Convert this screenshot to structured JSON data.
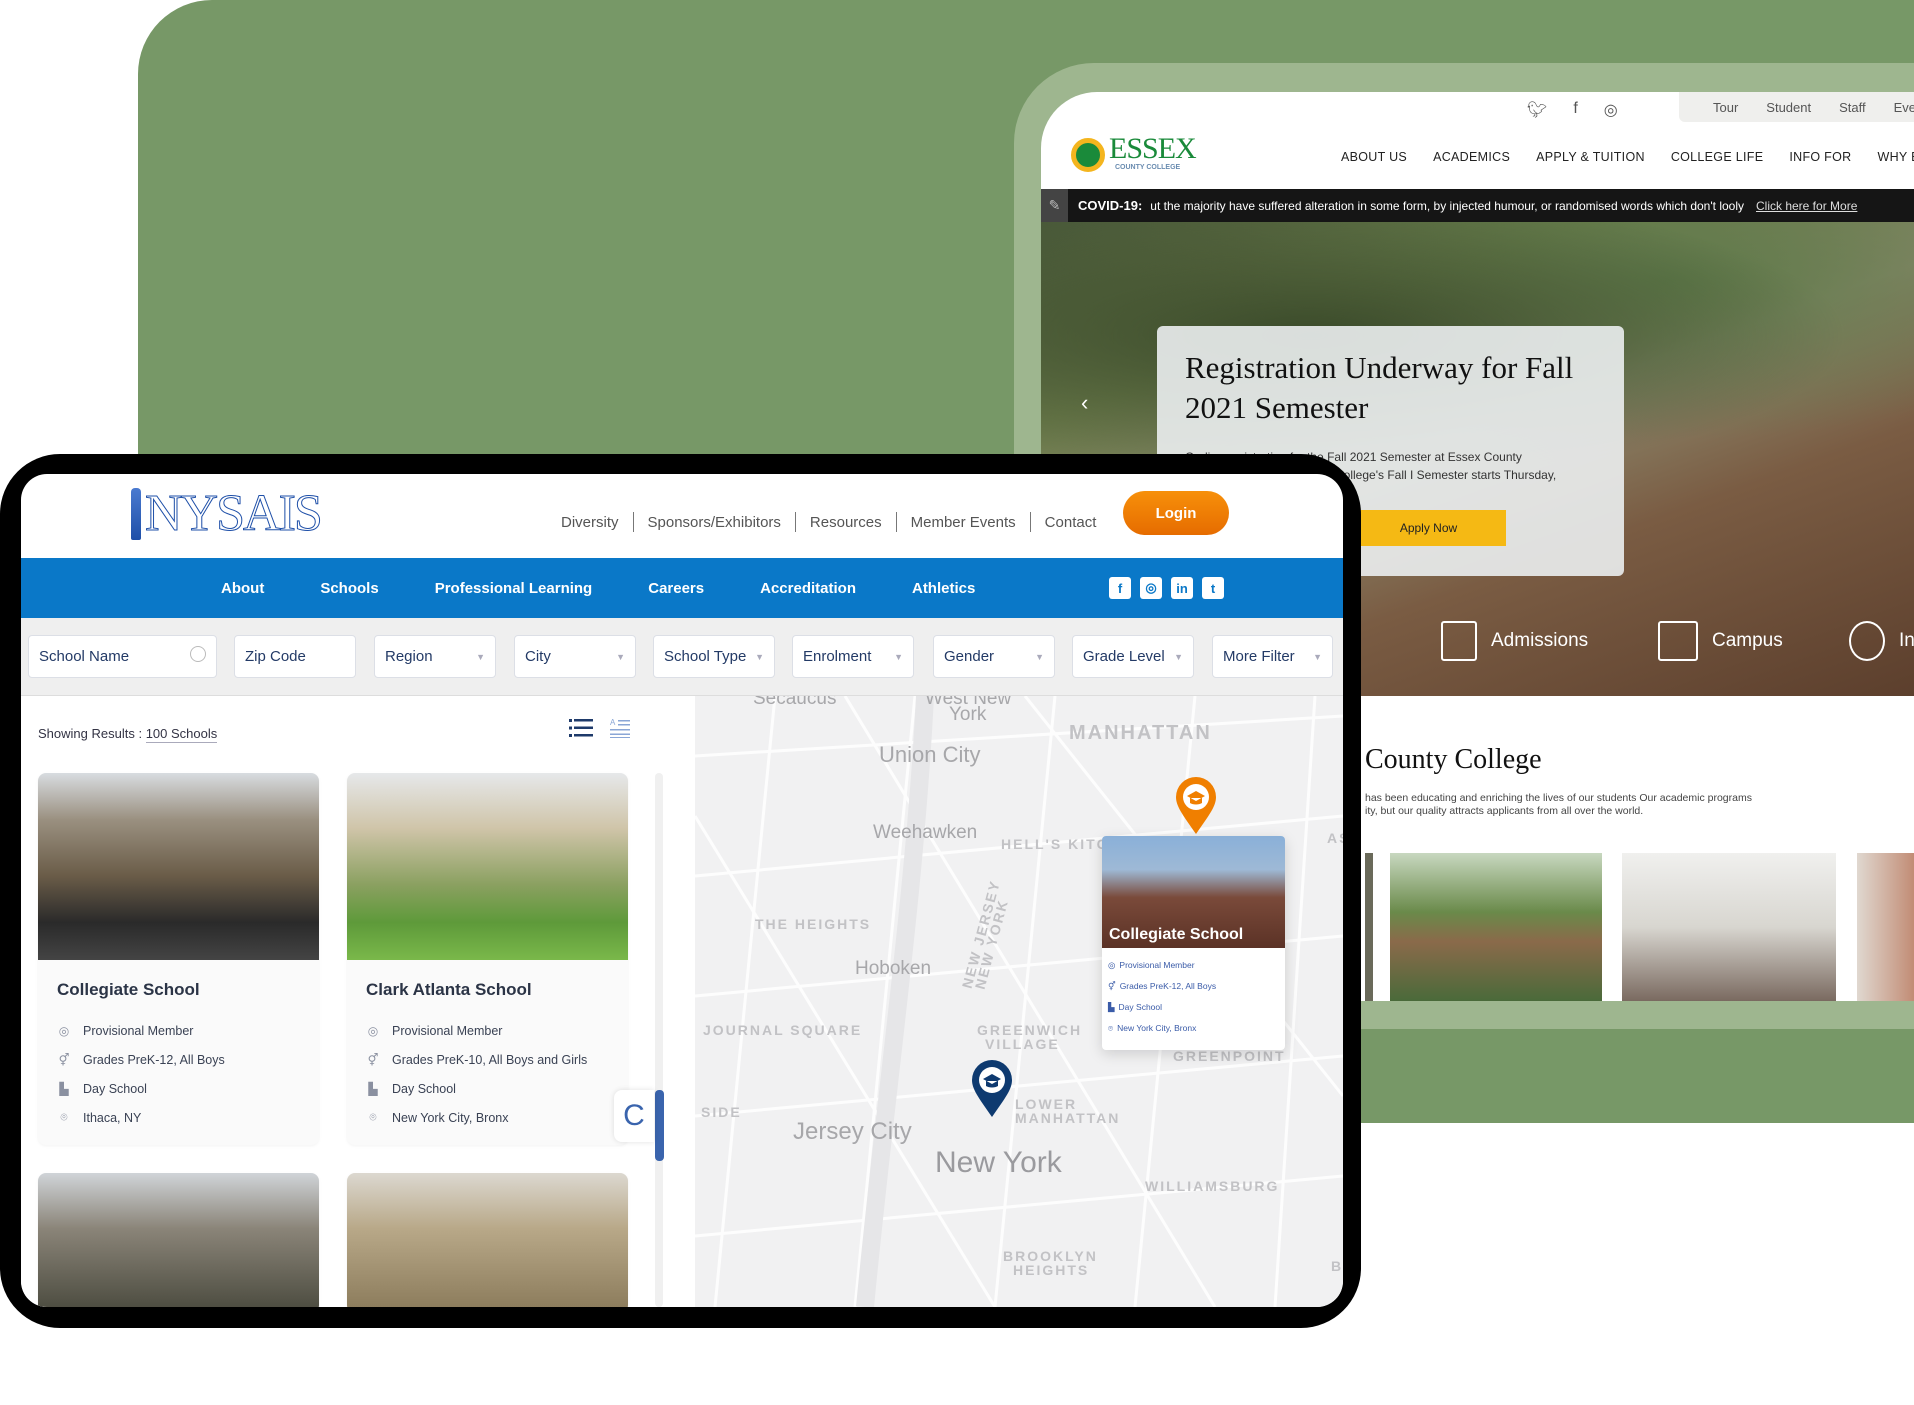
{
  "essex": {
    "social_icons": [
      "twitter-icon",
      "facebook-icon",
      "instagram-icon"
    ],
    "top_tabs": [
      "Tour",
      "Student",
      "Staff",
      "Eve"
    ],
    "logo_text": "ESSEX",
    "logo_sub": "COUNTY COLLEGE",
    "nav": [
      "ABOUT US",
      "ACADEMICS",
      "APPLY & TUITION",
      "COLLEGE LIFE",
      "INFO FOR",
      "WHY ECC"
    ],
    "covid_label": "COVID-19:",
    "covid_text": "ut the majority have suffered alteration in some form, by injected humour, or randomised words which don't looly",
    "covid_link": "Click here for More",
    "hero_title_1": "Registration Underway for Fall",
    "hero_title_2": "2021 Semester",
    "hero_text_1": "On-line registration for the Fall 2021 Semester at Essex County",
    "hero_text_2": "College's Fall I Semester starts Thursday,",
    "apply_button": "Apply Now",
    "quick_links": [
      "Admissions",
      "Campus",
      "In"
    ],
    "section_title": "County College",
    "section_text_1": "has been educating and enriching the lives of our students Our academic programs",
    "section_text_2": "ity, but our quality attracts applicants from all over the world.",
    "accent": "#f5b914"
  },
  "nysais": {
    "logo_text": "NYSAIS",
    "top_links": [
      "Diversity",
      "Sponsors/Exhibitors",
      "Resources",
      "Member Events",
      "Contact"
    ],
    "login_button": "Login",
    "main_nav": [
      "About",
      "Schools",
      "Professional Learning",
      "Careers",
      "Accreditation",
      "Athletics"
    ],
    "social": [
      "f",
      "◎",
      "in",
      "t"
    ],
    "filters": {
      "school_name_placeholder": "School Name",
      "zip_placeholder": "Zip Code",
      "region": "Region",
      "city": "City",
      "school_type": "School Type",
      "enrolment": "Enrolment",
      "gender": "Gender",
      "grade_level": "Grade Level",
      "more_filter": "More Filter"
    },
    "results_label": "Showing Results  :",
    "results_count": "100 Schools",
    "schools": [
      {
        "name": "Collegiate School",
        "membership": "Provisional Member",
        "grades": "Grades PreK-12, All Boys",
        "type": "Day School",
        "location": "Ithaca, NY"
      },
      {
        "name": "Clark Atlanta School",
        "membership": "Provisional Member",
        "grades": "Grades PreK-10, All Boys and Girls",
        "type": "Day School",
        "location": "New York City, Bronx"
      }
    ],
    "chat_button": "C",
    "map_labels": {
      "secaucus": "Secaucus",
      "wny_1": "West New",
      "wny_2": "York",
      "manhattan": "MANHATTAN",
      "union_city": "Union City",
      "weehawken": "Weehawken",
      "hells_kitchen": "HELL'S KITCHEN",
      "astoria": "ASTO",
      "heights": "THE HEIGHTS",
      "new_jersey": "NEW JERSEY",
      "new_york_state": "NEW YORK",
      "hoboken": "Hoboken",
      "journal_square": "JOURNAL SQUARE",
      "greenwich_1": "GREENWICH",
      "greenwich_2": "VILLAGE",
      "greenpoint": "GREENPOINT",
      "side": "SIDE",
      "jersey_city": "Jersey City",
      "lower_1": "LOWER",
      "lower_2": "MANHATTAN",
      "new_york": "New York",
      "williamsburg": "WILLIAMSBURG",
      "brooklyn_1": "BROOKLYN",
      "brooklyn_2": "HEIGHTS",
      "bu": "BU"
    },
    "popup": {
      "name": "Collegiate School",
      "membership": "Provisional Member",
      "grades": "Grades PreK-12, All Boys",
      "type": "Day School",
      "location": "New York City, Bronx"
    },
    "colors": {
      "blue_bar": "#0a78c8",
      "login": "#f58a07",
      "pin_orange": "#f07f00",
      "pin_navy": "#0e3a70",
      "green_bg": "#779867"
    }
  }
}
